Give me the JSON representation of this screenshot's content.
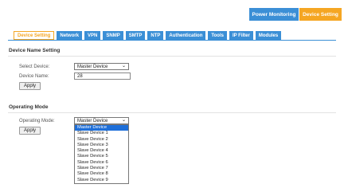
{
  "header": {
    "power_monitoring": "Power Monitoring",
    "device_setting": "Device Setting"
  },
  "tabs": [
    {
      "label": "Device Setting",
      "active": true
    },
    {
      "label": "Network",
      "active": false
    },
    {
      "label": "VPN",
      "active": false
    },
    {
      "label": "SNMP",
      "active": false
    },
    {
      "label": "SMTP",
      "active": false
    },
    {
      "label": "NTP",
      "active": false
    },
    {
      "label": "Authentication",
      "active": false
    },
    {
      "label": "Tools",
      "active": false
    },
    {
      "label": "IP Filter",
      "active": false
    },
    {
      "label": "Modules",
      "active": false
    }
  ],
  "device_name_setting": {
    "title": "Device Name Setting",
    "select_label": "Select Device:",
    "select_value": "Master Device",
    "name_label": "Device Name:",
    "name_value": "28",
    "apply_label": "Apply"
  },
  "operating_mode": {
    "title": "Operating Mode",
    "mode_label": "Operating Mode:",
    "mode_value": "Master Device",
    "apply_label": "Apply",
    "options": [
      "Master Device",
      "Slave Device 1",
      "Slave Device 2",
      "Slave Device 3",
      "Slave Device 4",
      "Slave Device 5",
      "Slave Device 6",
      "Slave Device 7",
      "Slave Device 8",
      "Slave Device 9"
    ],
    "selected_option": "Master Device"
  },
  "colors": {
    "tab_blue": "#3b8fd6",
    "accent_orange": "#f5a623",
    "option_highlight": "#1e6fd9"
  }
}
